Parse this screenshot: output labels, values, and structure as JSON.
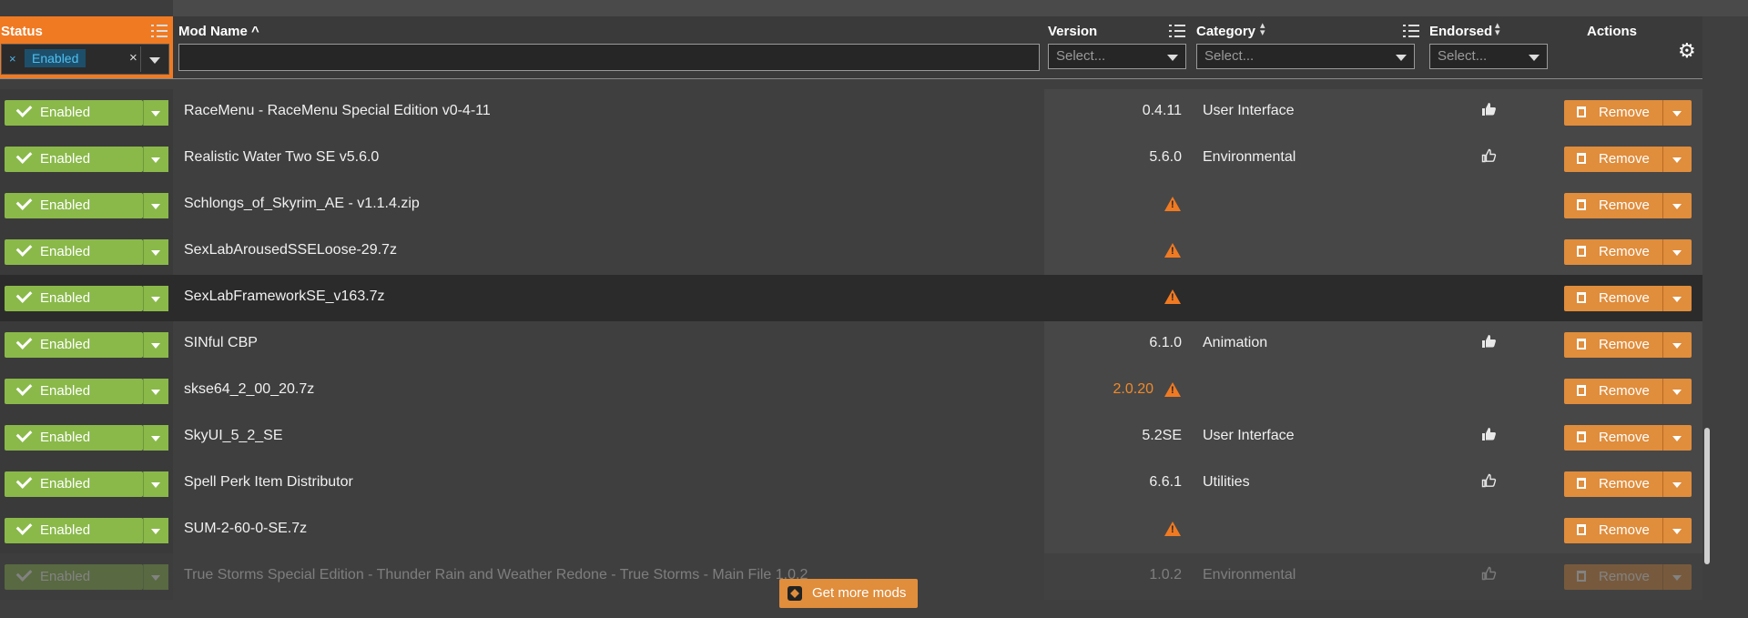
{
  "header": {
    "status_label": "Status",
    "status_filter_tag": "Enabled",
    "status_filter_remove": "×",
    "status_filter_clear": "×",
    "modname_label": "Mod Name ^",
    "modname_filter_value": "",
    "version_label": "Version",
    "category_label": "Category",
    "category_placeholder": "Select...",
    "endorsed_label": "Endorsed",
    "endorsed_placeholder": "Select...",
    "version_placeholder": "Select...",
    "actions_label": "Actions"
  },
  "rows": [
    {
      "status": "Enabled",
      "name": "RaceMenu - RaceMenu Special Edition v0-4-11",
      "version": "0.4.11",
      "warn": false,
      "category": "User Interface",
      "endorsed": "filled",
      "action": "Remove"
    },
    {
      "status": "Enabled",
      "name": "Realistic Water Two SE v5.6.0",
      "version": "5.6.0",
      "warn": false,
      "category": "Environmental",
      "endorsed": "outline",
      "action": "Remove"
    },
    {
      "status": "Enabled",
      "name": "Schlongs_of_Skyrim_AE - v1.1.4.zip",
      "version": "",
      "warn": true,
      "category": "",
      "endorsed": "none",
      "action": "Remove"
    },
    {
      "status": "Enabled",
      "name": "SexLabArousedSSELoose-29.7z",
      "version": "",
      "warn": true,
      "category": "",
      "endorsed": "none",
      "action": "Remove"
    },
    {
      "status": "Enabled",
      "name": "SexLabFrameworkSE_v163.7z",
      "version": "",
      "warn": true,
      "category": "",
      "endorsed": "none",
      "action": "Remove",
      "selected": true
    },
    {
      "status": "Enabled",
      "name": "SINful CBP",
      "version": "6.1.0",
      "warn": false,
      "category": "Animation",
      "endorsed": "filled",
      "action": "Remove"
    },
    {
      "status": "Enabled",
      "name": "skse64_2_00_20.7z",
      "version": "2.0.20",
      "warn": true,
      "version_warn": true,
      "category": "",
      "endorsed": "none",
      "action": "Remove"
    },
    {
      "status": "Enabled",
      "name": "SkyUI_5_2_SE",
      "version": "5.2SE",
      "warn": false,
      "category": "User Interface",
      "endorsed": "filled",
      "action": "Remove"
    },
    {
      "status": "Enabled",
      "name": "Spell Perk Item Distributor",
      "version": "6.6.1",
      "warn": false,
      "category": "Utilities",
      "endorsed": "outline",
      "action": "Remove"
    },
    {
      "status": "Enabled",
      "name": "SUM-2-60-0-SE.7z",
      "version": "",
      "warn": true,
      "category": "",
      "endorsed": "none",
      "action": "Remove"
    },
    {
      "status": "Enabled",
      "name": "True Storms Special Edition - Thunder Rain and Weather Redone - True Storms - Main File 1.0.2",
      "version": "1.0.2",
      "warn": false,
      "category": "Environmental",
      "endorsed": "outline",
      "action": "Remove",
      "faded": true
    }
  ],
  "footer": {
    "get_more_label": "Get more mods"
  },
  "colors": {
    "accent": "#f07a22",
    "enabled": "#8ab94a",
    "remove": "#e08d3c",
    "warning": "#f07a22"
  }
}
